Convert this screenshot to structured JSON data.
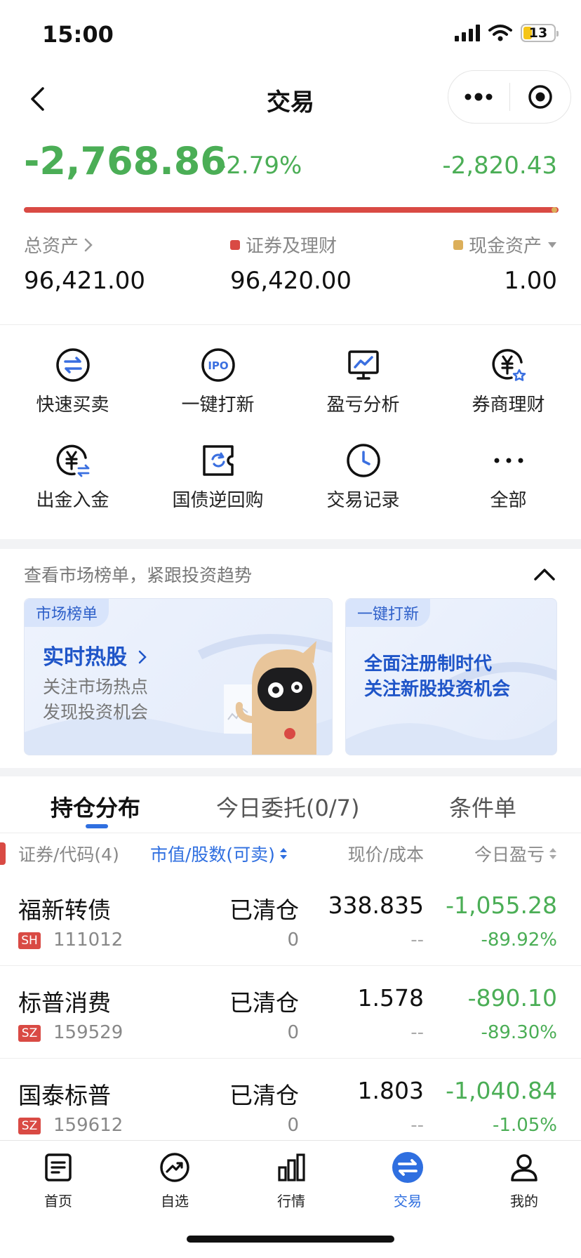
{
  "status_bar": {
    "time": "15:00",
    "battery": "13"
  },
  "nav": {
    "title": "交易"
  },
  "summary": {
    "today_pl": "-2,768.86",
    "today_pl_pct": "-2.79%",
    "total_pl": "-2,820.43",
    "assets": [
      {
        "label": "总资产",
        "value": "96,421.00"
      },
      {
        "label": "证券及理财",
        "value": "96,420.00"
      },
      {
        "label": "现金资产",
        "value": "1.00"
      }
    ],
    "colors": {
      "loss_green": "#4bae56",
      "securities_red": "#d94a44",
      "cash_gold": "#dcaf5a"
    }
  },
  "quick_actions": [
    {
      "label": "快速买卖",
      "icon": "swap-arrows-icon"
    },
    {
      "label": "一键打新",
      "icon": "ipo-icon"
    },
    {
      "label": "盈亏分析",
      "icon": "chart-monitor-icon"
    },
    {
      "label": "券商理财",
      "icon": "yen-star-icon"
    },
    {
      "label": "出金入金",
      "icon": "yen-transfer-icon"
    },
    {
      "label": "国债逆回购",
      "icon": "refresh-ticket-icon"
    },
    {
      "label": "交易记录",
      "icon": "clock-icon"
    },
    {
      "label": "全部",
      "icon": "more-dots-icon"
    }
  ],
  "market": {
    "hint": "查看市场榜单，紧跟投资趋势",
    "card1": {
      "tag": "市场榜单",
      "title": "实时热股",
      "line1": "关注市场热点",
      "line2": "发现投资机会"
    },
    "card2": {
      "tag": "一键打新",
      "line1": "全面注册制时代",
      "line2": "关注新股投资机会"
    }
  },
  "holdings": {
    "tabs": [
      "持仓分布",
      "今日委托(0/7)",
      "条件单"
    ],
    "columns": [
      "证券/代码(4)",
      "市值/股数(可卖)",
      "现价/成本",
      "今日盈亏"
    ],
    "rows": [
      {
        "name": "福新转债",
        "market": "SH",
        "code": "111012",
        "status": "已清仓",
        "qty": "0",
        "price": "338.835",
        "cost": "--",
        "pl": "-1,055.28",
        "pl_pct": "-89.92%"
      },
      {
        "name": "标普消费",
        "market": "SZ",
        "code": "159529",
        "status": "已清仓",
        "qty": "0",
        "price": "1.578",
        "cost": "--",
        "pl": "-890.10",
        "pl_pct": "-89.30%"
      },
      {
        "name": "国泰标普",
        "market": "SZ",
        "code": "159612",
        "status": "已清仓",
        "qty": "0",
        "price": "1.803",
        "cost": "--",
        "pl": "-1,040.84",
        "pl_pct": "-1.05%"
      }
    ]
  },
  "tabbar": [
    {
      "label": "首页",
      "icon": "home-doc-icon"
    },
    {
      "label": "自选",
      "icon": "trend-icon"
    },
    {
      "label": "行情",
      "icon": "bar-chart-icon"
    },
    {
      "label": "交易",
      "icon": "exchange-icon",
      "active": true
    },
    {
      "label": "我的",
      "icon": "user-icon"
    }
  ]
}
